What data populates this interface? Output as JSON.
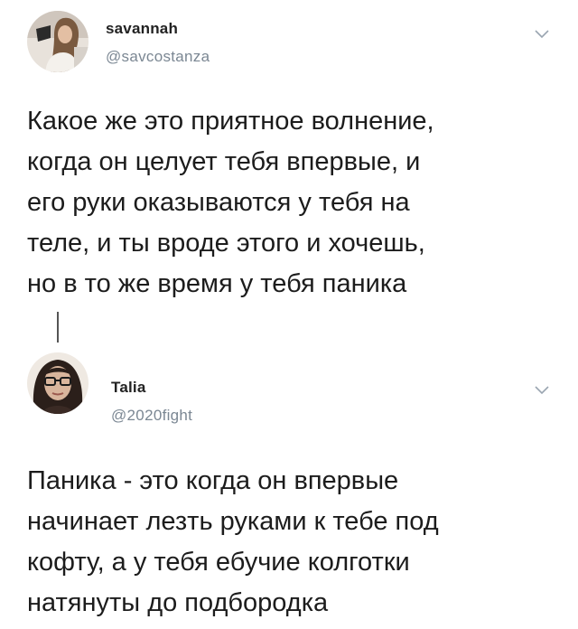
{
  "tweets": [
    {
      "display_name": "savannah",
      "handle": "@savcostanza",
      "lines": [
        "Какое же это приятное волнение,",
        "когда он целует тебя впервые, и",
        "его руки оказываются у тебя на",
        "теле, и ты вроде этого и хочешь,",
        "но в то же время у тебя паника"
      ]
    },
    {
      "display_name": "Talia",
      "handle": "@2020fight",
      "lines": [
        "Паника - это когда он впервые",
        "начинает лезть руками к тебе под",
        "кофту, а у тебя ебучие колготки",
        "натянуты до подбородка"
      ]
    }
  ],
  "icons": {
    "more_options": "chevron-down-icon"
  },
  "colors": {
    "handle": "#7b8793",
    "text": "#1c1c1c",
    "chevron": "#9aa5b1"
  }
}
